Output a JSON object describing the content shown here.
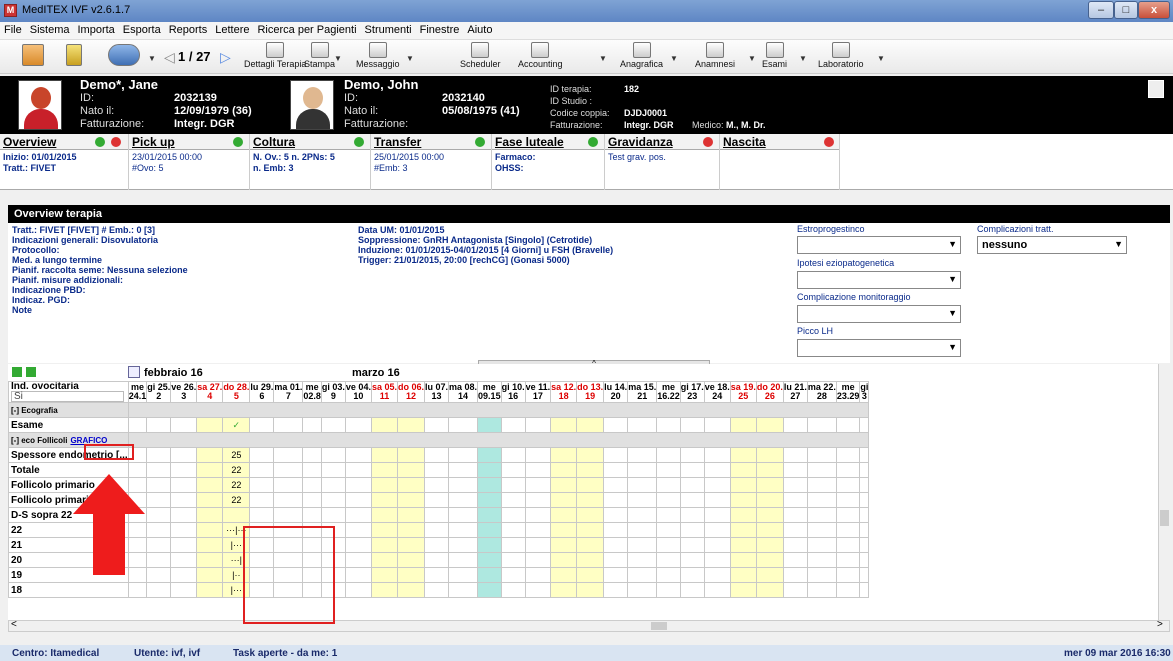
{
  "window": {
    "title": "MedITEX IVF v2.6.1.7",
    "app_icon": "ivf-app-icon",
    "buttons": [
      "–",
      "□",
      "x"
    ]
  },
  "menu": [
    "File",
    "Sistema",
    "Importa",
    "Esporta",
    "Reports",
    "Lettere",
    "Ricerca per Pagienti",
    "Strumenti",
    "Finestre",
    "Aiuto"
  ],
  "toolbar": {
    "pager": "1 / 27",
    "items": [
      "Dettagli Terapia",
      "Stampa",
      "Messaggio",
      "Scheduler",
      "Accounting",
      "Anagrafica",
      "Anamnesi",
      "Esami",
      "Laboratorio"
    ]
  },
  "patient_f": {
    "name": "Demo*, Jane",
    "id_label": "ID:",
    "id": "2032139",
    "born_label": "Nato il:",
    "born": "12/09/1979  (36)",
    "billing_label": "Fatturazione:",
    "billing": "Integr. DGR"
  },
  "patient_m": {
    "name": "Demo, John",
    "id_label": "ID:",
    "id": "2032140",
    "born_label": "Nato il:",
    "born": "05/08/1975  (41)",
    "billing_label": "Fatturazione:"
  },
  "couple": {
    "therapy_id_label": "ID terapia:",
    "therapy_id": "182",
    "study_label": "ID Studio :",
    "couple_code_label": "Codice coppia:",
    "couple_code": "DJDJ0001",
    "billing_label": "Fatturazione:",
    "billing": "Integr. DGR",
    "doctor_label": "Medico:",
    "doctor": "M., M. Dr."
  },
  "phases": [
    {
      "title": "Overview",
      "lines": [
        "Inizio: 01/01/2015",
        "Tratt.: FIVET"
      ]
    },
    {
      "title": "Pick up",
      "lines": [
        "23/01/2015 00:00",
        "#Ovo: 5"
      ]
    },
    {
      "title": "Coltura",
      "lines": [
        "N. Ov.: 5  n. 2PNs: 5",
        "n. Emb: 3"
      ]
    },
    {
      "title": "Transfer",
      "lines": [
        "25/01/2015 00:00",
        "#Emb: 3"
      ]
    },
    {
      "title": "Fase luteale",
      "lines": [
        "Farmaco:",
        "OHSS:"
      ]
    },
    {
      "title": "Gravidanza",
      "lines": [
        "Test grav. pos.",
        ""
      ]
    },
    {
      "title": "Nascita",
      "lines": [
        "",
        ""
      ]
    }
  ],
  "overview": {
    "title": "Overview terapia",
    "left": [
      "Tratt.: FIVET   [FIVET]    # Emb.: 0   [3]",
      "Indicazioni generali: Disovulatoria",
      "Protocollo:",
      "Med. a lungo termine",
      "Pianif. raccolta seme: Nessuna selezione",
      "Pianif. misure addizionali:",
      "Indicazione PBD:",
      "Indicaz. PGD:",
      "Note"
    ],
    "middle": [
      "Data UM: 01/01/2015",
      "Soppressione: GnRH Antagonista [Singolo] (Cetrotide)",
      "Induzione: 01/01/2015-04/01/2015 [4 Giorni] u FSH (Bravelle)",
      "Trigger: 21/01/2015, 20:00  [rechCG] (Gonasi 5000)"
    ],
    "fields": [
      {
        "label": "Estroprogestinco",
        "value": ""
      },
      {
        "label": "Ipotesi eziopatogenetica",
        "value": ""
      },
      {
        "label": "Complicazione monitoraggio",
        "value": ""
      },
      {
        "label": "Picco LH",
        "value": ""
      },
      {
        "label": "Complicazioni tratt.",
        "value": "nessuno"
      }
    ]
  },
  "calendar": {
    "months": [
      "febbraio 16",
      "marzo 16"
    ],
    "row_label": "Ind. ovocitaria",
    "row_select": "Si",
    "days": [
      [
        "me",
        "24.1"
      ],
      [
        "gi 25.",
        "2"
      ],
      [
        "ve 26.",
        "3"
      ],
      [
        "sa 27.",
        "4"
      ],
      [
        "do 28.",
        "5"
      ],
      [
        "lu 29.",
        "6"
      ],
      [
        "ma 01.",
        "7"
      ],
      [
        "me",
        "02.8"
      ],
      [
        "gi 03.",
        "9"
      ],
      [
        "ve 04.",
        "10"
      ],
      [
        "sa 05.",
        "11"
      ],
      [
        "do 06.",
        "12"
      ],
      [
        "lu 07.",
        "13"
      ],
      [
        "ma 08.",
        "14"
      ],
      [
        "me",
        "09.15"
      ],
      [
        "gi 10.",
        "16"
      ],
      [
        "ve 11.",
        "17"
      ],
      [
        "sa 12.",
        "18"
      ],
      [
        "do 13.",
        "19"
      ],
      [
        "lu 14.",
        "20"
      ],
      [
        "ma 15.",
        "21"
      ],
      [
        "me",
        "16.22"
      ],
      [
        "gi 17.",
        "23"
      ],
      [
        "ve 18.",
        "24"
      ],
      [
        "sa 19.",
        "25"
      ],
      [
        "do 20.",
        "26"
      ],
      [
        "lu 21.",
        "27"
      ],
      [
        "ma 22.",
        "28"
      ],
      [
        "me",
        "23.29"
      ],
      [
        "gi",
        "3"
      ]
    ],
    "sections": {
      "eco": "[-] Ecografia",
      "foll": "[-] eco Follicoli",
      "grafico": "GRAFICO"
    },
    "rows": [
      {
        "label": "Esame",
        "mark": "✓"
      },
      {
        "label": "Spessore endometrio [...",
        "mark": "25"
      },
      {
        "label": "Totale",
        "mark": "22"
      },
      {
        "label": "Follicolo primario",
        "mark": "22"
      },
      {
        "label": "Follicolo primario",
        "mark": "22"
      },
      {
        "label": "D-S sopra 22",
        "mark": ""
      },
      {
        "label": "22",
        "mark": "···|···"
      },
      {
        "label": "21",
        "mark": "|···"
      },
      {
        "label": "20",
        "mark": "···|"
      },
      {
        "label": "19",
        "mark": "|··"
      },
      {
        "label": "18",
        "mark": "|···"
      }
    ]
  },
  "status": {
    "center": "Centro: Itamedical",
    "user": "Utente: ivf, ivf",
    "tasks": "Task aperte - da me: 1",
    "datetime": "mer 09 mar 2016 16:30"
  }
}
